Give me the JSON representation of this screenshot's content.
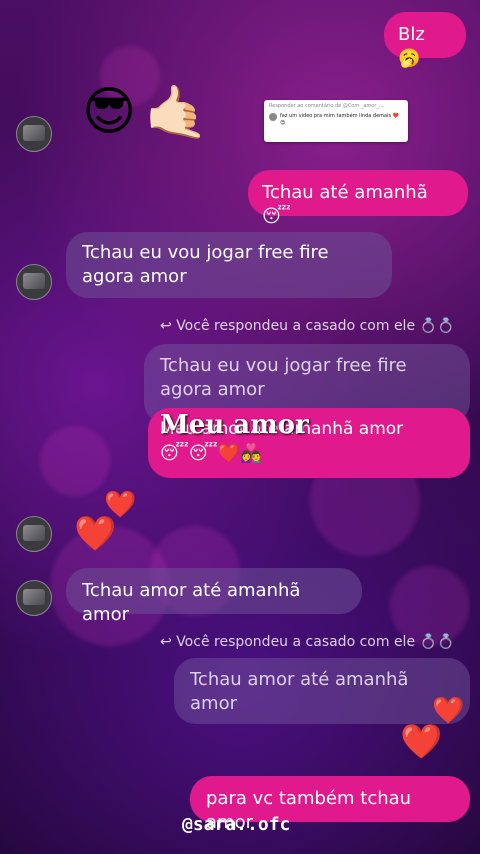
{
  "messages": {
    "blz": "Blz",
    "tchau_sent": "Tchau até amanhã",
    "tchau_recv": "Tchau eu vou jogar free fire agora amor",
    "reply1_label": "Você respondeu a casado com ele",
    "reply1_quote": "Tchau eu vou jogar free fire agora amor",
    "meu_amor_title": "Meu amor",
    "meu_amor_text": "Meu amor até amanhã amor",
    "tchau_amor_recv": "Tchau amor até amanhã amor",
    "reply2_label": "Você respondeu a casado com ele",
    "reply2_quote": "Tchau amor até amanhã amor",
    "final_sent": "para vc também tchau amor"
  },
  "comment_card": {
    "header": "Responder ao comentário de @Com _amor_...",
    "text": "faz um video pra mim também linda demais"
  },
  "watermark": "@sara..ofc",
  "colors": {
    "sent": "#e0198c",
    "received": "#6e5096",
    "background": "#3a0b56"
  },
  "icons": [
    "sleepy-face-icon",
    "sunglasses-face-icon",
    "call-me-hand-icon",
    "reply-arrow-icon",
    "ring-icon",
    "red-heart-icon",
    "couple-icon",
    "avatar-icon"
  ]
}
